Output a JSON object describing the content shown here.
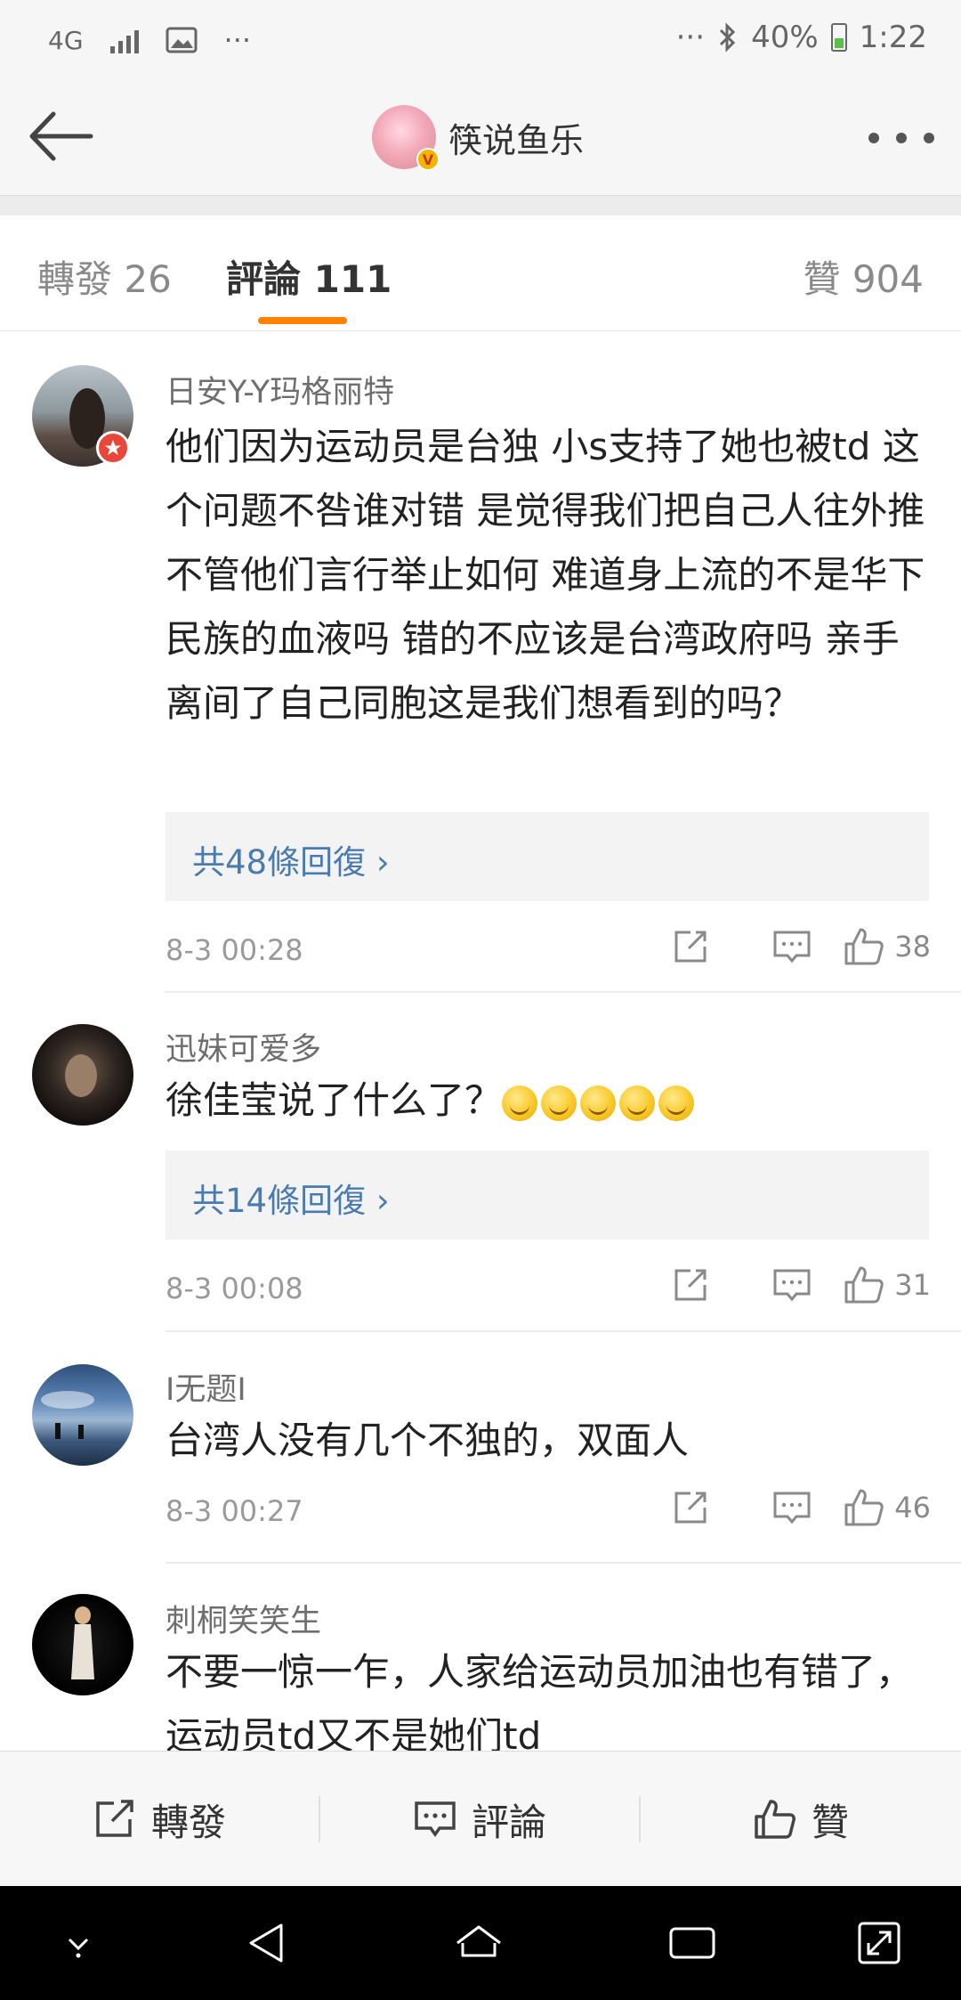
{
  "status_bar": {
    "network": "4G",
    "more": "···",
    "more_right": "···",
    "battery": "40%",
    "time": "1:22"
  },
  "header": {
    "title": "筷说鱼乐",
    "vip_badge": "V"
  },
  "tabs": [
    {
      "label": "轉發 26"
    },
    {
      "label": "評論 111"
    },
    {
      "label": "贊 904"
    }
  ],
  "comments": [
    {
      "user": "日安Y-Y玛格丽特",
      "text": "他们因为运动员是台独 小s支持了她也被td 这个问题不咎谁对错 是觉得我们把自己人往外推 不管他们言行举止如何 难道身上流的不是华下民族的血液吗 错的不应该是台湾政府吗 亲手离间了自己同胞这是我们想看到的吗？",
      "replies": "共48條回復 ›",
      "time": "8-3 00:28",
      "likes": "38"
    },
    {
      "user": "迅妹可爱多",
      "text": "徐佳莹说了什么了？",
      "replies": "共14條回復 ›",
      "time": "8-3 00:08",
      "likes": "31"
    },
    {
      "user": "I无题I",
      "text": "台湾人没有几个不独的，双面人",
      "time": "8-3 00:27",
      "likes": "46"
    },
    {
      "user": "刺桐笑笑生",
      "text": "不要一惊一乍，人家给运动员加油也有错了，运动员td又不是她们td"
    }
  ],
  "action_bar": {
    "repost": "轉發",
    "comment": "評論",
    "like": "贊"
  },
  "colors": {
    "accent": "#ff8200",
    "link": "#4a7bb0"
  }
}
